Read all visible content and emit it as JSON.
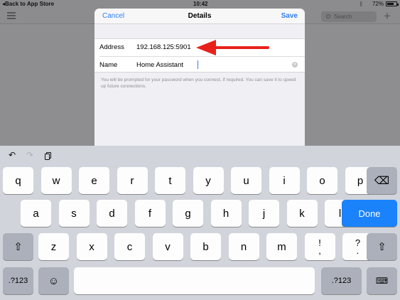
{
  "status_bar": {
    "back_label": "Back to App Store",
    "time": "10:42",
    "battery": "72%",
    "battery_level": 0.72
  },
  "background_app": {
    "search_placeholder": "Search",
    "add_label": "+"
  },
  "sheet": {
    "title": "Details",
    "cancel_label": "Cancel",
    "save_label": "Save",
    "fields": [
      {
        "label": "Address",
        "value": "192.168.125:5901"
      },
      {
        "label": "Name",
        "value": "Home Assistant"
      }
    ],
    "hint": "You will be prompted for your password when you connect, if required. You can save it to speed up future connections."
  },
  "annotation": {
    "color": "#e8221b"
  },
  "keyboard": {
    "row1": [
      "q",
      "w",
      "e",
      "r",
      "t",
      "y",
      "u",
      "i",
      "o",
      "p"
    ],
    "row2": [
      "a",
      "s",
      "d",
      "f",
      "g",
      "h",
      "j",
      "k",
      "l"
    ],
    "row3": [
      "z",
      "x",
      "c",
      "v",
      "b",
      "n",
      "m"
    ],
    "punct1": [
      "!",
      ","
    ],
    "punct2": [
      "?",
      "."
    ],
    "done_label": "Done",
    "numbers_label": ".?123",
    "accent": "#1a82fb",
    "icons": {
      "undo": "undo-icon",
      "redo": "redo-icon",
      "paste": "paste-icon",
      "backspace": "backspace-icon",
      "shift": "shift-icon",
      "emoji": "emoji-icon",
      "dismiss": "keyboard-dismiss-icon"
    }
  }
}
